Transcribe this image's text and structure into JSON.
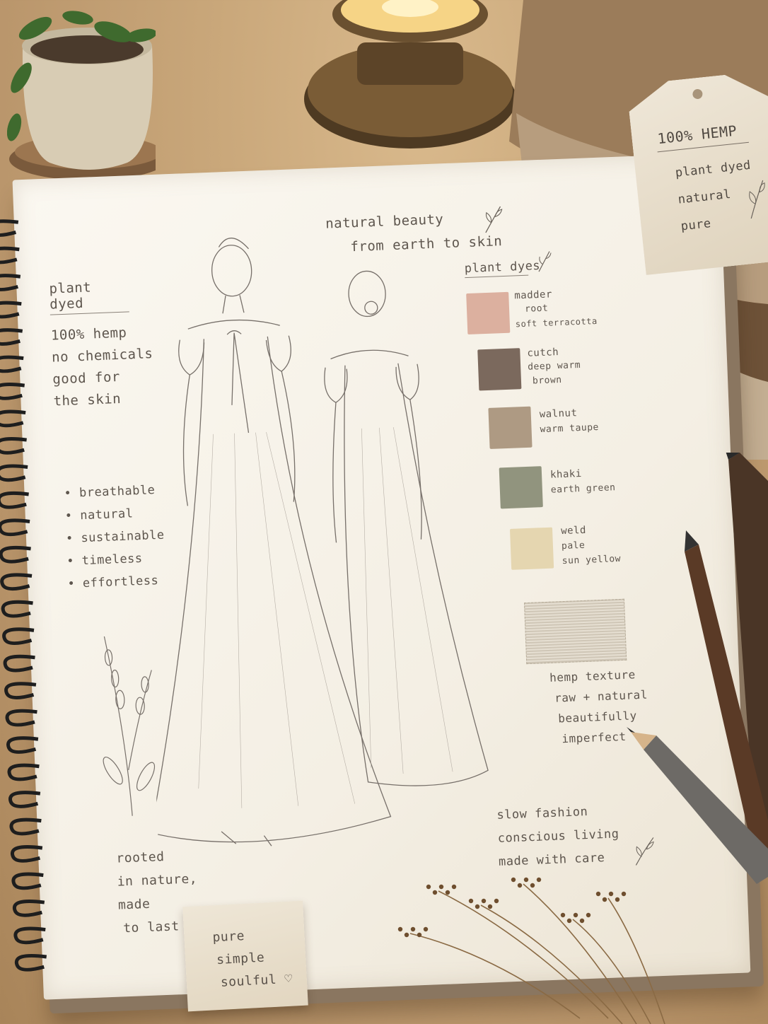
{
  "tag": {
    "title": "100% HEMP",
    "lines": [
      "plant dyed",
      "natural",
      "pure"
    ]
  },
  "header": {
    "line1": "natural beauty",
    "line2": "from earth to skin"
  },
  "left_notes": {
    "heading": "plant dyed",
    "lines": [
      "100% hemp",
      "no chemicals",
      "good for",
      "the skin"
    ]
  },
  "qualities": [
    "• breathable",
    "• natural",
    "• sustainable",
    "• timeless",
    "• effortless"
  ],
  "dyes": {
    "heading": "plant dyes",
    "items": [
      {
        "lines": [
          "madder",
          "root",
          "soft terracotta"
        ],
        "color": "#d9a897"
      },
      {
        "lines": [
          "cutch",
          "deep warm",
          "brown"
        ],
        "color": "#6e5a4e"
      },
      {
        "lines": [
          "walnut",
          "warm taupe"
        ],
        "color": "#a69078"
      },
      {
        "lines": [
          "khaki",
          "earth green"
        ],
        "color": "#868a72"
      },
      {
        "lines": [
          "weld",
          "pale",
          "sun yellow"
        ],
        "color": "#e3d3aa"
      }
    ]
  },
  "hemp_texture": {
    "lines": [
      "hemp texture",
      "raw + natural",
      "beautifully",
      "imperfect"
    ]
  },
  "bottom_left": {
    "lines": [
      "rooted",
      "in nature,",
      "made",
      "to last"
    ]
  },
  "bottom_right": {
    "lines": [
      "slow fashion",
      "conscious living",
      "made with care"
    ]
  },
  "note_card": {
    "lines": [
      "pure",
      "simple",
      "soulful ♡"
    ]
  }
}
